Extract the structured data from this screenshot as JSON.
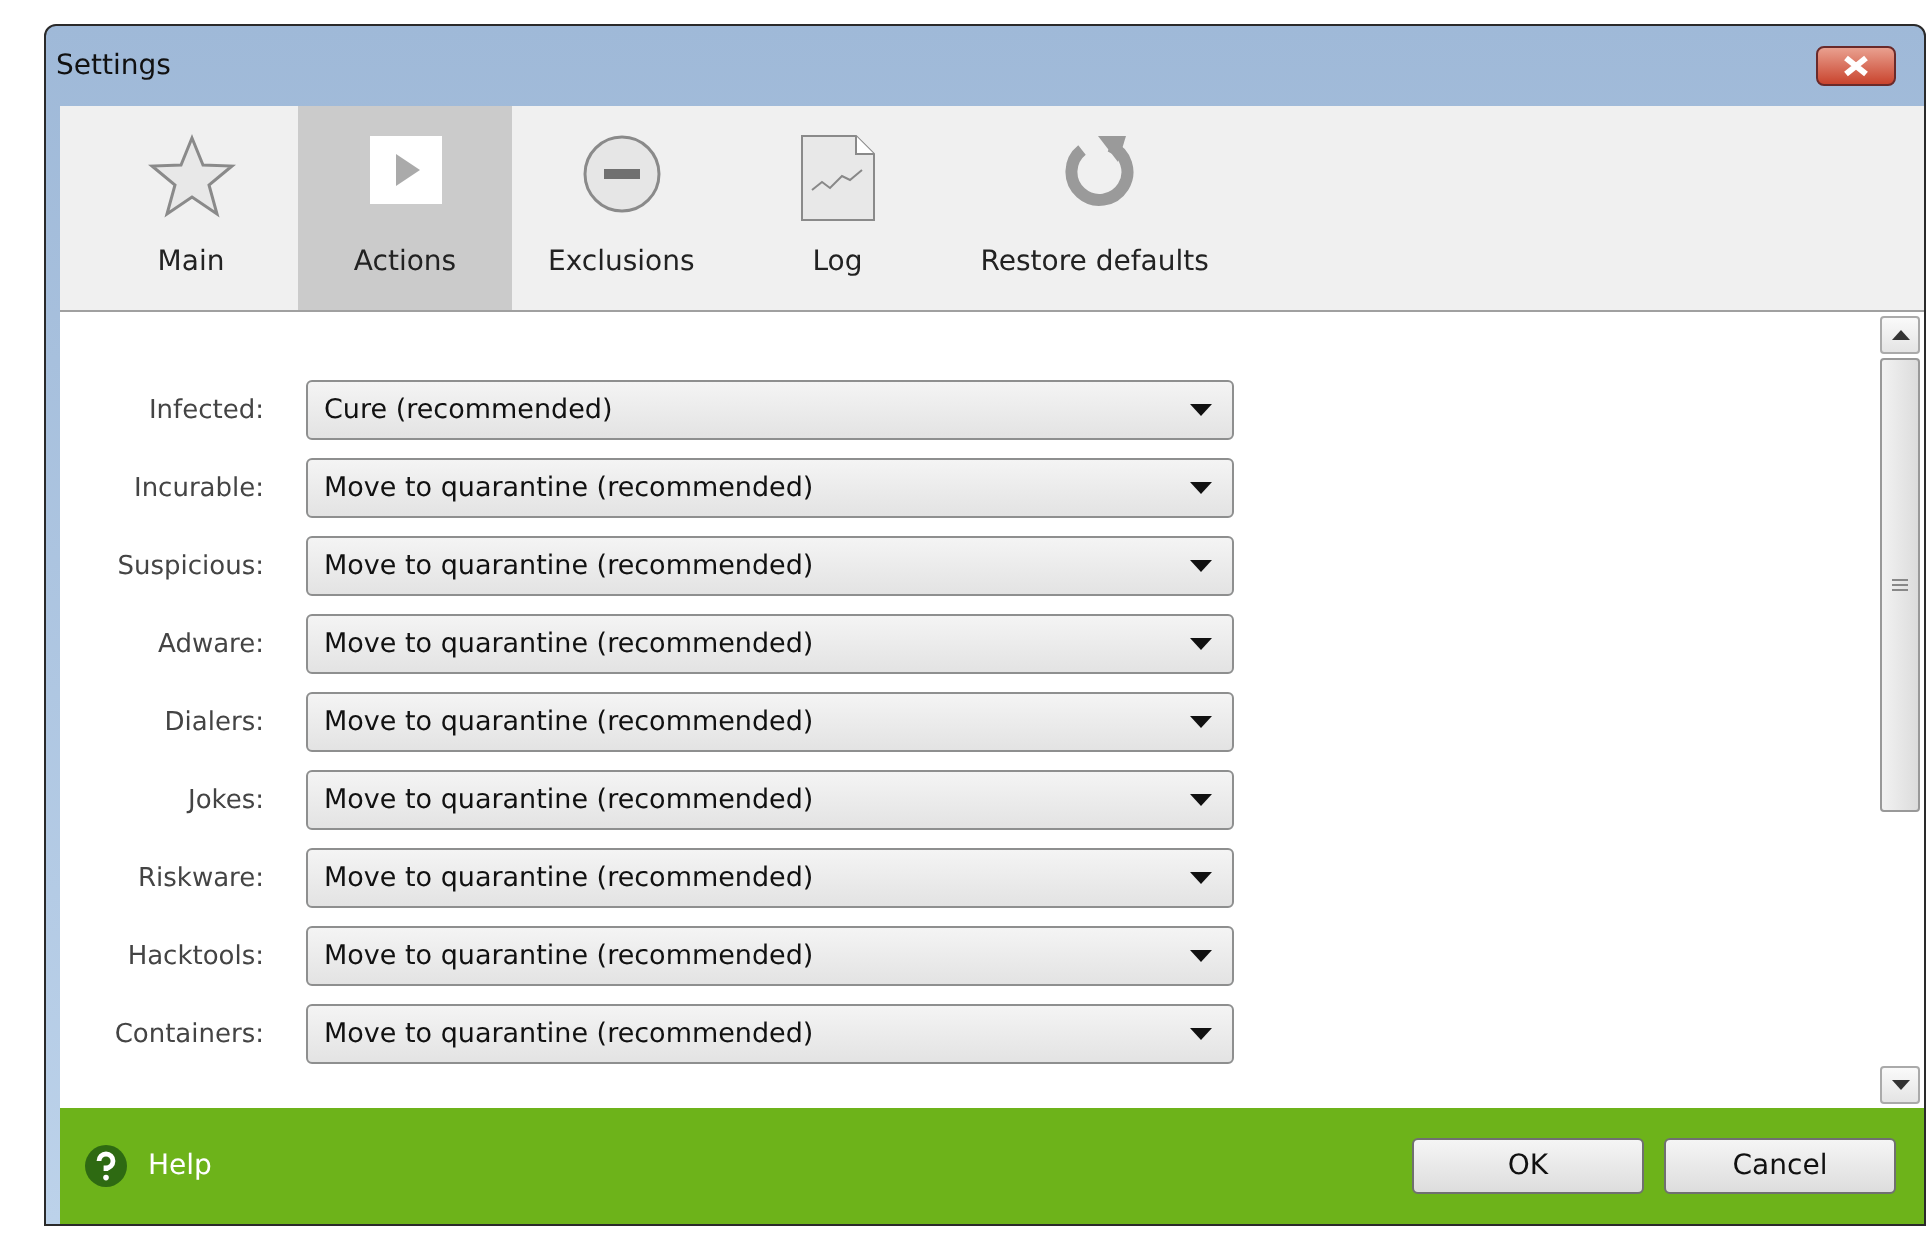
{
  "window": {
    "title": "Settings"
  },
  "toolbar": [
    {
      "label": "Main",
      "selected": false
    },
    {
      "label": "Actions",
      "selected": true
    },
    {
      "label": "Exclusions",
      "selected": false
    },
    {
      "label": "Log",
      "selected": false
    },
    {
      "label": "Restore defaults",
      "selected": false
    }
  ],
  "actions": [
    {
      "label": "Infected:",
      "value": "Cure (recommended)"
    },
    {
      "label": "Incurable:",
      "value": "Move to quarantine (recommended)"
    },
    {
      "label": "Suspicious:",
      "value": "Move to quarantine (recommended)"
    },
    {
      "label": "Adware:",
      "value": "Move to quarantine (recommended)"
    },
    {
      "label": "Dialers:",
      "value": "Move to quarantine (recommended)"
    },
    {
      "label": "Jokes:",
      "value": "Move to quarantine (recommended)"
    },
    {
      "label": "Riskware:",
      "value": "Move to quarantine (recommended)"
    },
    {
      "label": "Hacktools:",
      "value": "Move to quarantine (recommended)"
    },
    {
      "label": "Containers:",
      "value": "Move to quarantine (recommended)"
    }
  ],
  "footer": {
    "help": "Help",
    "buttons": [
      "OK",
      "Cancel"
    ]
  }
}
